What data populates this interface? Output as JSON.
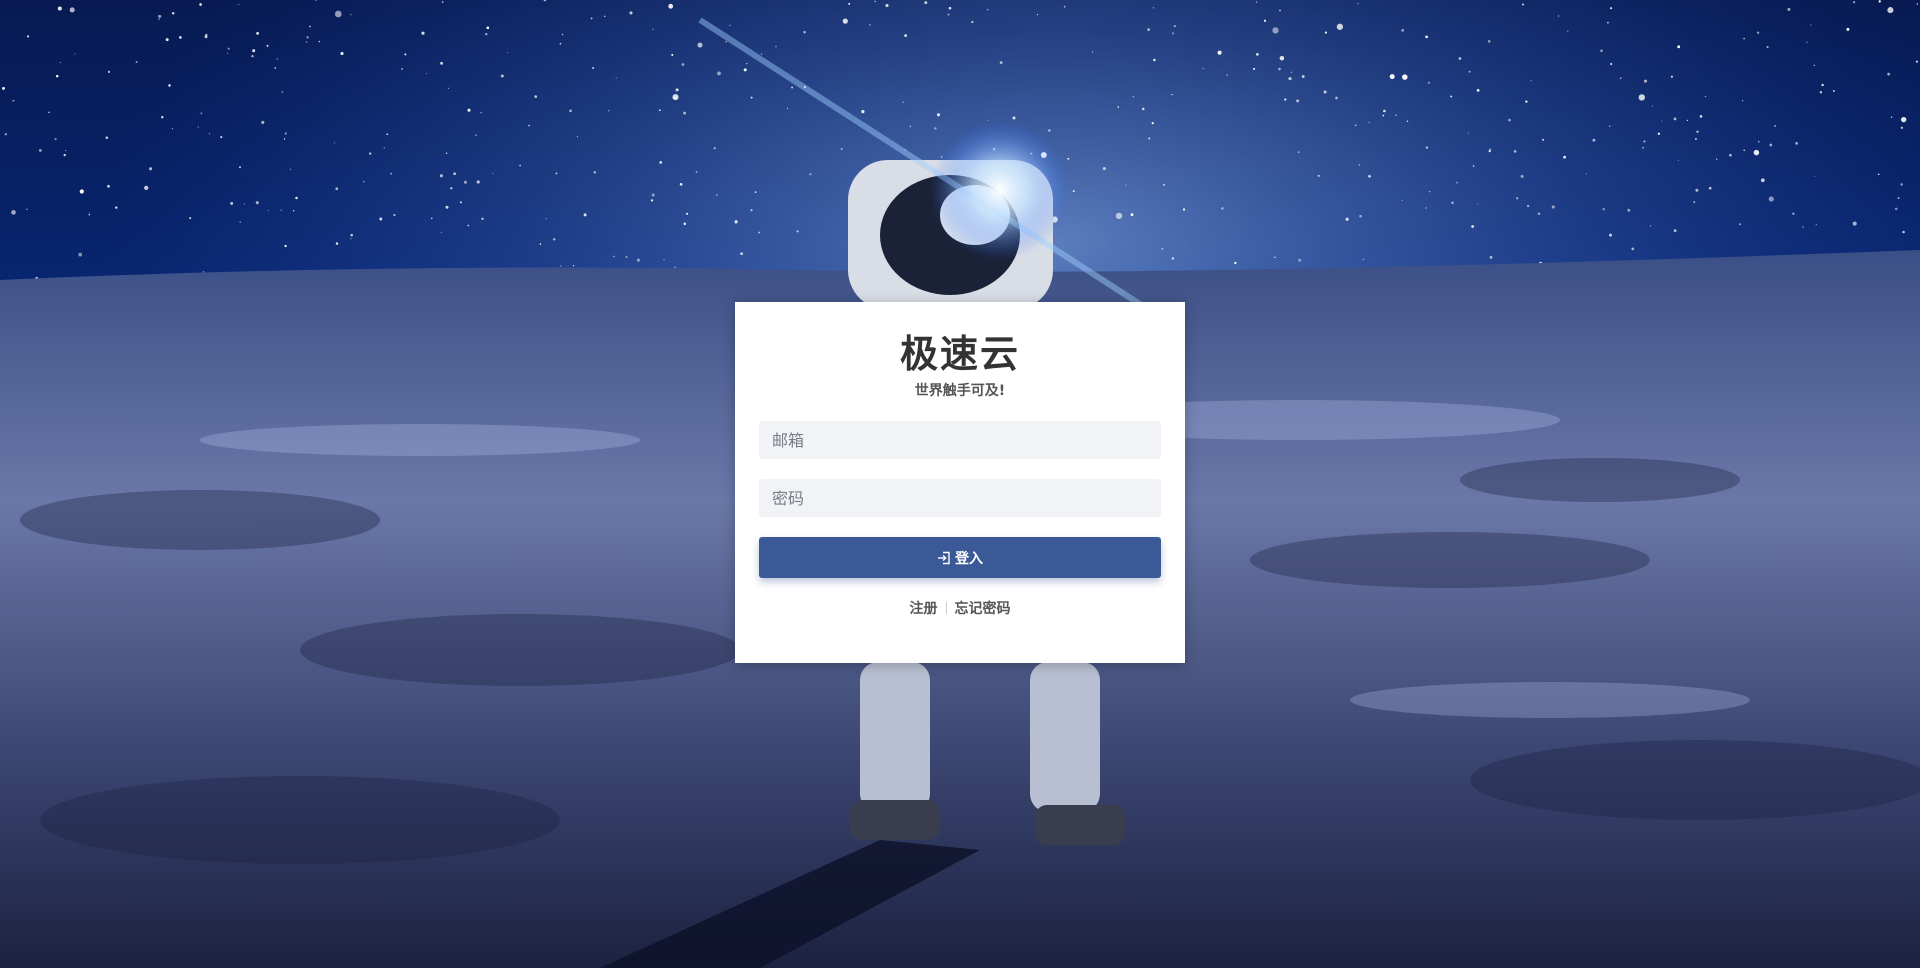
{
  "background": {
    "description_icon": "astronaut-moon-background"
  },
  "login": {
    "title": "极速云",
    "subtitle": "世界触手可及!",
    "email_placeholder": "邮箱",
    "password_placeholder": "密码",
    "login_label": "登入",
    "login_icon": "sign-in-icon",
    "register_label": "注册",
    "forgot_label": "忘记密码"
  },
  "colors": {
    "button": "#3b5996",
    "field_bg": "#f1f3f6",
    "title": "#333333"
  }
}
